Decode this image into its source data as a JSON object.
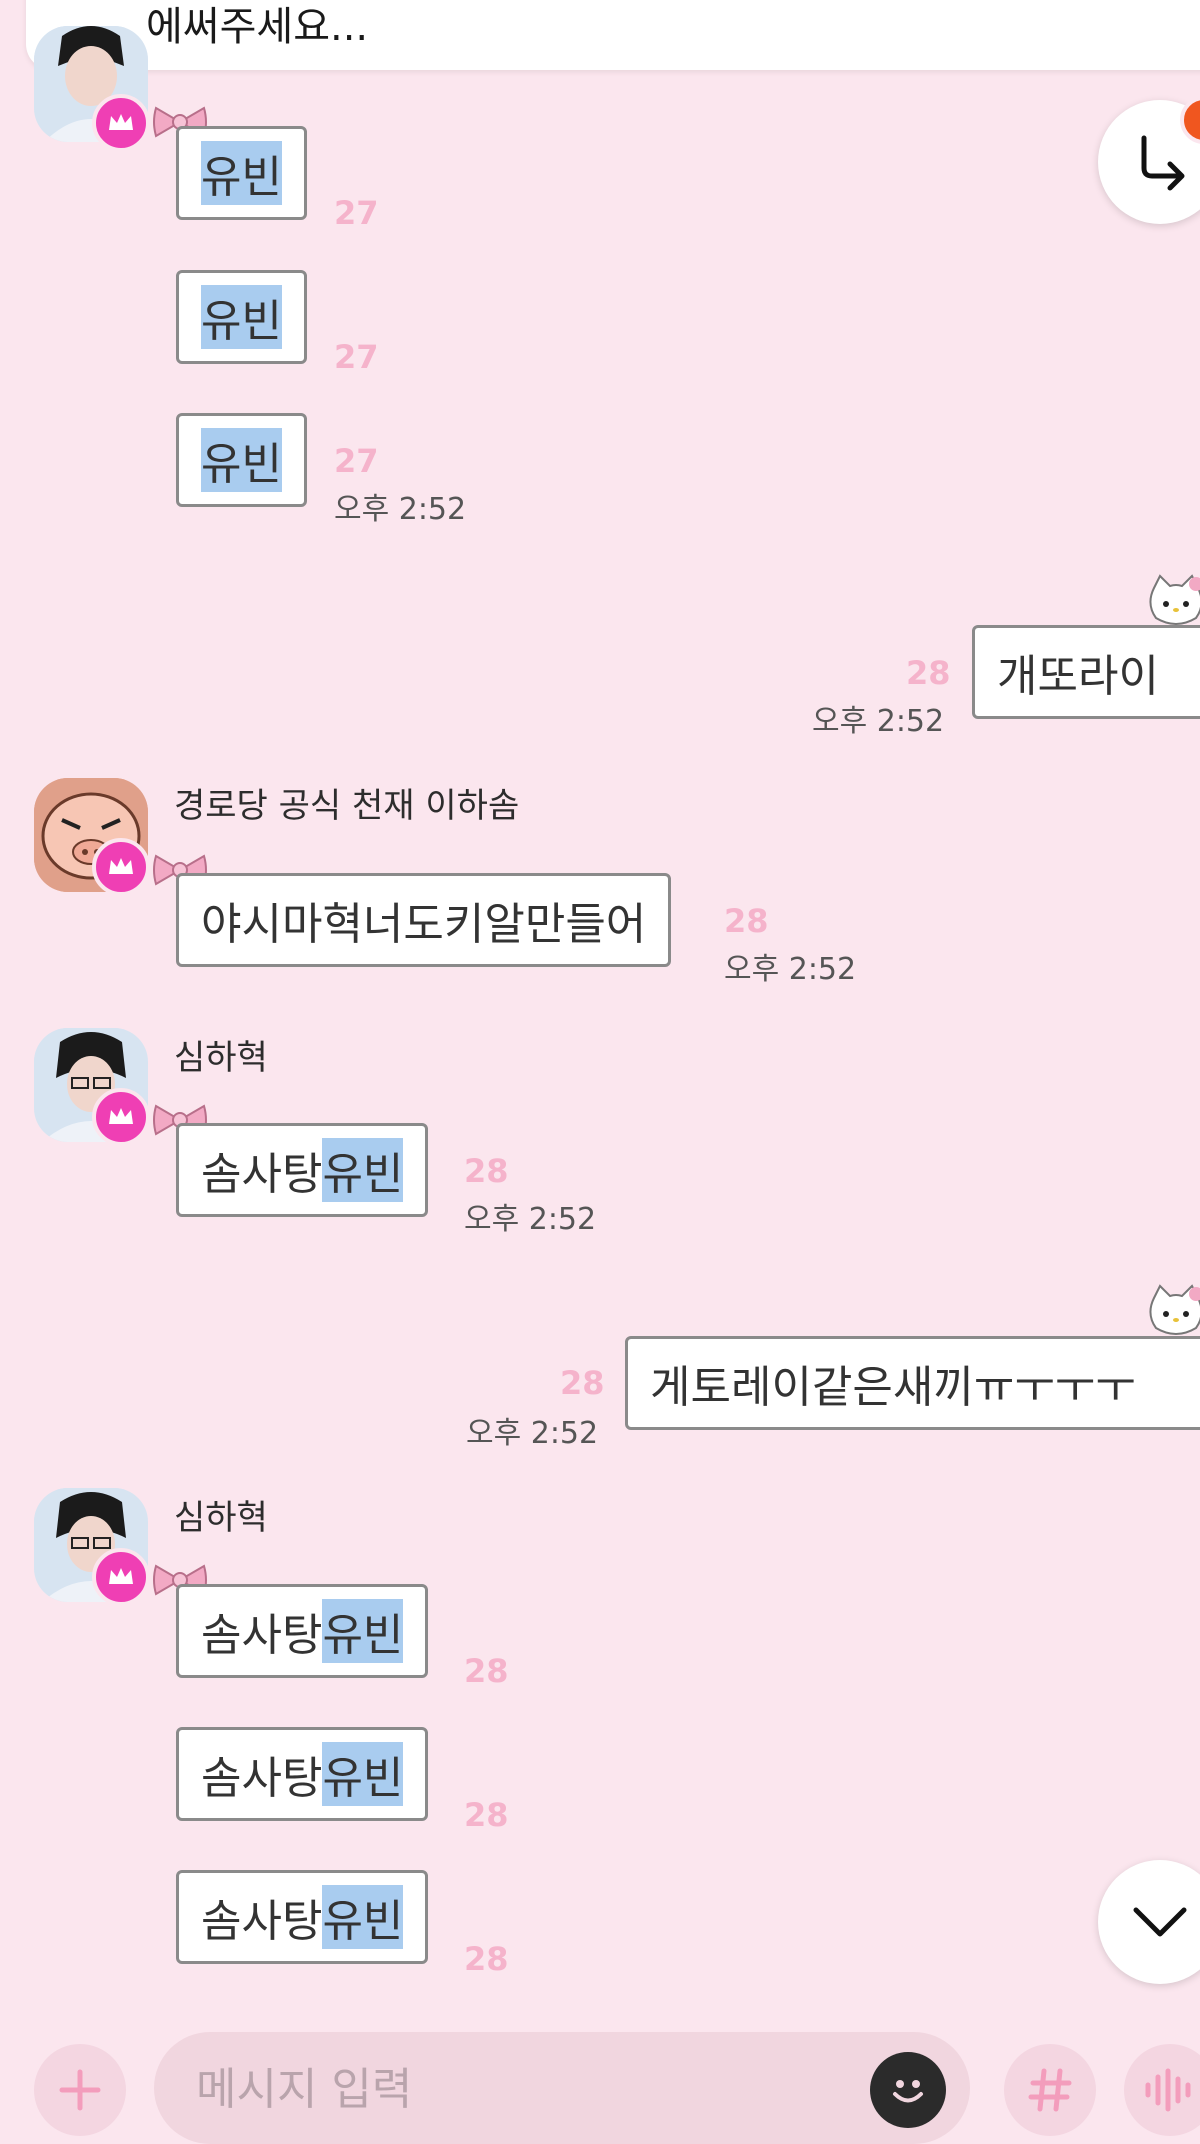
{
  "notice": {
    "text": "에써주세요..."
  },
  "messages": [
    {
      "id": "m1",
      "sender": "",
      "text_hl": "유빈",
      "count": "27"
    },
    {
      "id": "m2",
      "text_hl": "유빈",
      "count": "27"
    },
    {
      "id": "m3",
      "text_hl": "유빈",
      "count": "27",
      "time": "오후 2:52"
    },
    {
      "id": "m4",
      "text": "개또라이",
      "count": "28",
      "time": "오후 2:52"
    },
    {
      "id": "m5",
      "sender": "경로당 공식 천재 이하솜",
      "text": "야시마혁너도키알만들어",
      "count": "28",
      "time": "오후 2:52"
    },
    {
      "id": "m6",
      "sender": "심하혁",
      "text": "솜사탕",
      "text_hl": "유빈",
      "count": "28",
      "time": "오후 2:52"
    },
    {
      "id": "m7",
      "text": "게토레이같은새끼ㅠㅜㅜㅜ",
      "count": "28",
      "time": "오후 2:52"
    },
    {
      "id": "m8",
      "sender": "심하혁",
      "text": "솜사탕",
      "text_hl": "유빈",
      "count": "28"
    },
    {
      "id": "m9",
      "text": "솜사탕",
      "text_hl": "유빈",
      "count": "28"
    },
    {
      "id": "m10",
      "text": "솜사탕",
      "text_hl": "유빈",
      "count": "28"
    }
  ],
  "input": {
    "placeholder": "메시지 입력"
  },
  "icons": {
    "reply": "reply-arrow-icon",
    "scroll_down": "chevron-down-icon",
    "plus": "plus-icon",
    "emoji": "emoji-icon",
    "hashtag": "hashtag-icon",
    "voice": "voice-icon",
    "crown": "crown-icon",
    "bow": "bow-icon",
    "kitty": "kitty-icon"
  },
  "colors": {
    "background": "#fbe6ee",
    "read_count": "#f5b3cb",
    "crown_badge": "#ef3fb4",
    "highlight": "#a9ccef",
    "notification_badge": "#f0561f"
  }
}
